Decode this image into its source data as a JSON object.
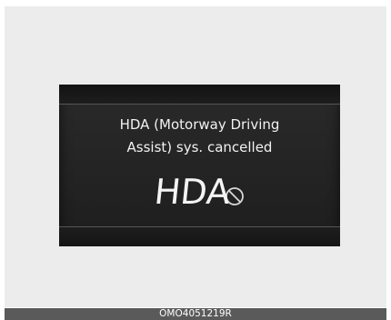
{
  "display": {
    "message_line1": "HDA (Motorway Driving",
    "message_line2": "Assist) sys. cancelled",
    "indicator_text": "HDA",
    "indicator_icon": "prohibited-icon"
  },
  "caption": {
    "code": "OMO4051219R"
  },
  "colors": {
    "screen_background": "#232323",
    "text": "#f2f2f2",
    "frame_background": "#ececec",
    "caption_bar": "#5a5a5a"
  }
}
